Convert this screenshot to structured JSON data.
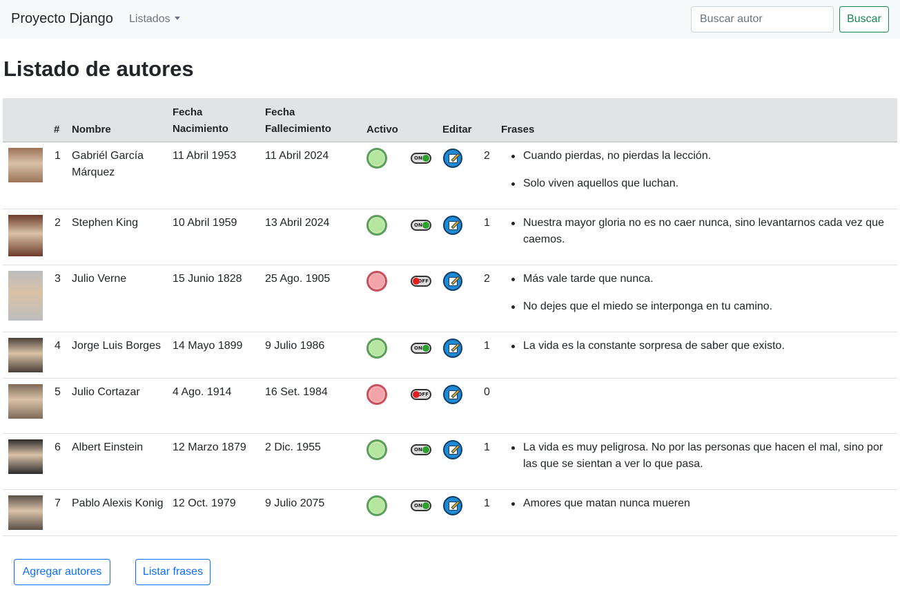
{
  "navbar": {
    "brand": "Proyecto Django",
    "dropdown_label": "Listados",
    "search_placeholder": "Buscar autor",
    "search_button": "Buscar"
  },
  "page_title": "Listado de autores",
  "table": {
    "headers": {
      "num": "#",
      "nombre": "Nombre",
      "fecha_nac_1": "Fecha",
      "fecha_nac_2": "Nacimiento",
      "fecha_fall_1": "Fecha",
      "fecha_fall_2": "Fallecimiento",
      "activo": "Activo",
      "editar": "Editar",
      "frases": "Frases"
    },
    "rows": [
      {
        "num": "1",
        "nombre_1": "Gabriél García",
        "nombre_2": "Márquez",
        "nacimiento": "11 Abril 1953",
        "fallecimiento": "11 Abril 2024",
        "activo": true,
        "toggle": "ON",
        "count": "2",
        "frases": [
          "Cuando pierdas, no pierdas la lección.",
          "Solo viven aquellos que luchan."
        ]
      },
      {
        "num": "2",
        "nombre_1": "Stephen King",
        "nombre_2": "",
        "nacimiento": "10 Abril 1959",
        "fallecimiento": "13 Abril 2024",
        "activo": true,
        "toggle": "ON",
        "count": "1",
        "frases": [
          "Nuestra mayor gloria no es no caer nunca, sino levantarnos cada vez que caemos."
        ]
      },
      {
        "num": "3",
        "nombre_1": "Julio Verne",
        "nombre_2": "",
        "nacimiento": "15 Junio 1828",
        "fallecimiento": "25 Ago. 1905",
        "activo": false,
        "toggle": "OFF",
        "count": "2",
        "frases": [
          "Más vale tarde que nunca.",
          "No dejes que el miedo se interponga en tu camino."
        ]
      },
      {
        "num": "4",
        "nombre_1": "Jorge Luis Borges",
        "nombre_2": "",
        "nacimiento": "14 Mayo 1899",
        "fallecimiento": "9 Julio 1986",
        "activo": true,
        "toggle": "ON",
        "count": "1",
        "frases": [
          "La vida es la constante sorpresa de saber que existo."
        ]
      },
      {
        "num": "5",
        "nombre_1": "Julio Cortazar",
        "nombre_2": "",
        "nacimiento": "4 Ago. 1914",
        "fallecimiento": "16 Set. 1984",
        "activo": false,
        "toggle": "OFF",
        "count": "0",
        "frases": []
      },
      {
        "num": "6",
        "nombre_1": "Albert Einstein",
        "nombre_2": "",
        "nacimiento": "12 Marzo 1879",
        "fallecimiento": "2 Dic. 1955",
        "activo": true,
        "toggle": "ON",
        "count": "1",
        "frases": [
          "La vida es muy peligrosa. No por las personas que hacen el mal, sino por las que se sientan a ver lo que pasa."
        ]
      },
      {
        "num": "7",
        "nombre_1": "Pablo Alexis Konig",
        "nombre_2": "",
        "nacimiento": "12 Oct. 1979",
        "fallecimiento": "9 Julio 2075",
        "activo": true,
        "toggle": "ON",
        "count": "1",
        "frases": [
          "Amores que matan nunca mueren"
        ]
      }
    ]
  },
  "footer": {
    "add_button": "Agregar autores",
    "list_button": "Listar frases"
  },
  "colors": {
    "active": "#b6e5a0",
    "inactive": "#f3a4ab",
    "primary": "#0d6efd",
    "success": "#198754",
    "header_bg": "#e2e3e5"
  }
}
